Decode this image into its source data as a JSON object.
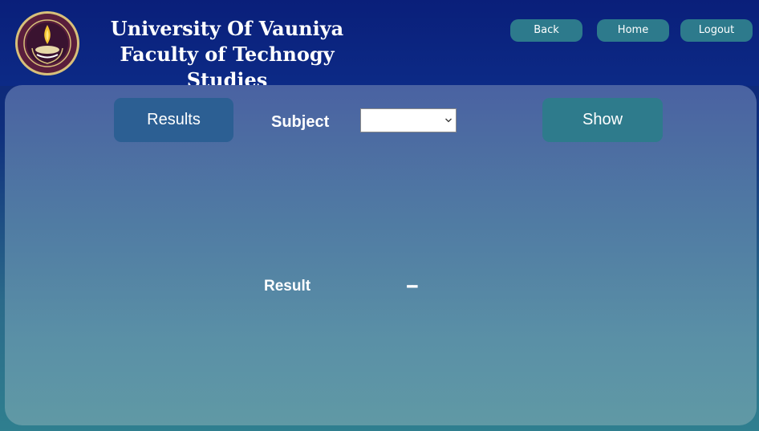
{
  "header": {
    "title_line1": "University Of Vauniya",
    "title_line2": "Faculty of Technogy Studies",
    "logo_icon": "university-crest-icon",
    "buttons": {
      "back": "Back",
      "home": "Home",
      "logout": "Logout"
    }
  },
  "main": {
    "results_button": "Results",
    "subject_label": "Subject",
    "subject_selected": "",
    "show_button": "Show",
    "result_label": "Result",
    "result_value": "--"
  },
  "colors": {
    "header_bg": "#0a1f7a",
    "button_teal": "#2d7a8c",
    "results_button_bg": "#2c5f93",
    "panel_top": "#4a62a2",
    "panel_bottom": "#6099a5",
    "text": "#ffffff"
  }
}
